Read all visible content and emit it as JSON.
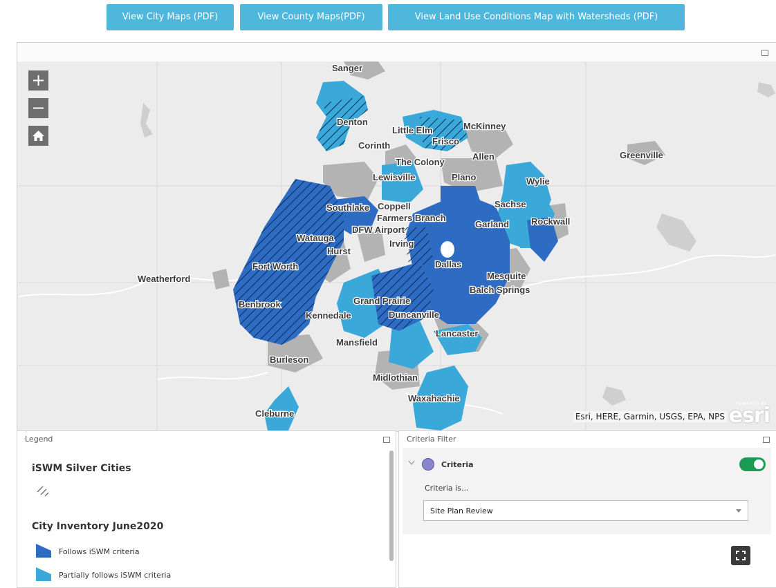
{
  "buttons": [
    {
      "label": "View City Maps (PDF)"
    },
    {
      "label": "View County Maps(PDF)"
    },
    {
      "label": "View Land Use Conditions Map with Watersheds (PDF)"
    }
  ],
  "map": {
    "controls": {
      "zoom_in": "+",
      "zoom_out": "−"
    },
    "attribution": "Esri, HERE, Garmin, USGS, EPA, NPS",
    "logo": {
      "powered_by": "POWERED BY",
      "brand": "esri"
    },
    "colors": {
      "follows": "#2e6bc2",
      "partially_follows": "#3aa8d8",
      "other_city": "#b3b3b3",
      "basemap": "#ececec"
    },
    "labels": [
      "Sanger",
      "Denton",
      "Little Elm",
      "Frisco",
      "McKinney",
      "Corinth",
      "The Colony",
      "Allen",
      "Greenville",
      "Lewisville",
      "Plano",
      "Wylie",
      "Southlake",
      "Coppell",
      "Sachse",
      "Farmers Branch",
      "Garland",
      "Rockwall",
      "DFW Airport",
      "Watauga",
      "Irving",
      "Hurst",
      "Fort Worth",
      "Dallas",
      "Weatherford",
      "Mesquite",
      "Balch Springs",
      "Benbrook",
      "Grand Prairie",
      "Kennedale",
      "Duncanville",
      "Lancaster",
      "Mansfield",
      "Burleson",
      "Midlothian",
      "Waxahachie",
      "Cleburne"
    ]
  },
  "legend": {
    "header": "Legend",
    "silver_title": "iSWM Silver Cities",
    "inventory_title": "City Inventory June2020",
    "items": [
      {
        "label": "Follows iSWM criteria",
        "color": "#2e6bc2"
      },
      {
        "label": "Partially follows iSWM criteria",
        "color": "#3aa8d8"
      }
    ]
  },
  "criteria": {
    "header": "Criteria Filter",
    "name": "Criteria",
    "toggle_on": true,
    "condition": "Criteria is...",
    "selected": "Site Plan Review"
  }
}
